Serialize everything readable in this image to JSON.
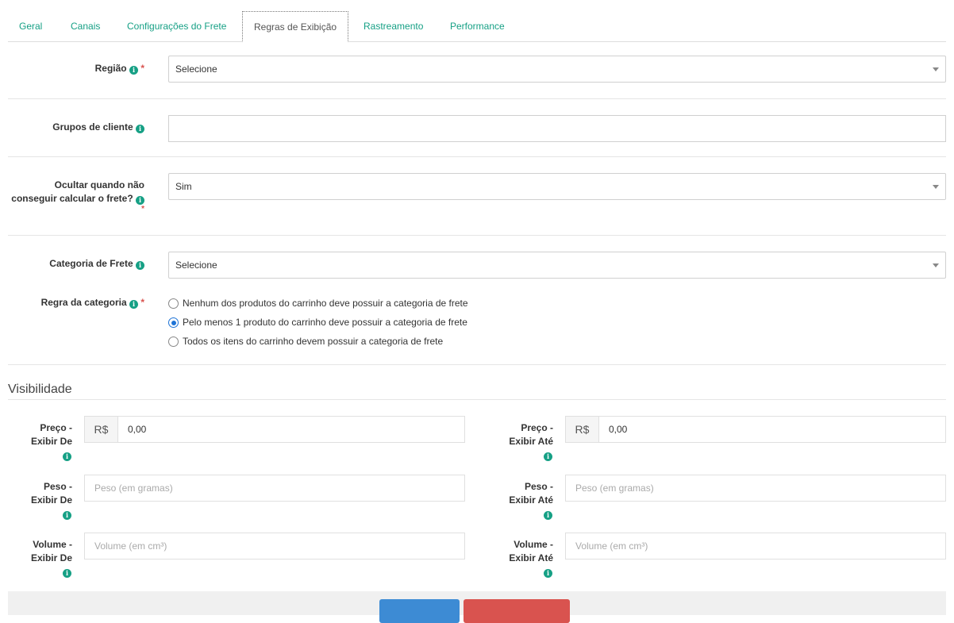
{
  "tabs": [
    {
      "label": "Geral"
    },
    {
      "label": "Canais"
    },
    {
      "label": "Configurações do Frete"
    },
    {
      "label": "Regras de Exibição"
    },
    {
      "label": "Rastreamento"
    },
    {
      "label": "Performance"
    }
  ],
  "regiao": {
    "label": "Região",
    "required": "*",
    "value": "Selecione"
  },
  "grupos": {
    "label": "Grupos de cliente",
    "value": ""
  },
  "ocultar": {
    "label_line1": "Ocultar quando não",
    "label_line2": "conseguir calcular o frete?",
    "required": "*",
    "value": "Sim"
  },
  "categoria": {
    "label": "Categoria de Frete",
    "value": "Selecione"
  },
  "regra": {
    "label": "Regra da categoria",
    "required": "*",
    "options": [
      {
        "label": "Nenhum dos produtos do carrinho deve possuir a categoria de frete",
        "checked": false
      },
      {
        "label": "Pelo menos 1 produto do carrinho deve possuir a categoria de frete",
        "checked": true
      },
      {
        "label": "Todos os itens do carrinho devem possuir a categoria de frete",
        "checked": false
      }
    ]
  },
  "visibilidade": {
    "title": "Visibilidade",
    "preco_de": {
      "label_line1": "Preço -",
      "label_line2": "Exibir De",
      "addon": "R$",
      "value": "0,00"
    },
    "preco_ate": {
      "label_line1": "Preço -",
      "label_line2": "Exibir Até",
      "addon": "R$",
      "value": "0,00"
    },
    "peso_de": {
      "label_line1": "Peso -",
      "label_line2": "Exibir De",
      "placeholder": "Peso (em gramas)"
    },
    "peso_ate": {
      "label_line1": "Peso -",
      "label_line2": "Exibir Até",
      "placeholder": "Peso (em gramas)"
    },
    "volume_de": {
      "label_line1": "Volume -",
      "label_line2": "Exibir De",
      "placeholder": "Volume (em cm³)"
    },
    "volume_ate": {
      "label_line1": "Volume -",
      "label_line2": "Exibir Até",
      "placeholder": "Volume (em cm³)"
    }
  },
  "icons": {
    "info": "info-icon",
    "caret": "chevron-down-icon"
  },
  "colors": {
    "accent": "#16a085",
    "required": "#d9534f",
    "radio": "#1e73d6",
    "primary_button": "#3d8bd4",
    "danger_button": "#d9534f"
  }
}
